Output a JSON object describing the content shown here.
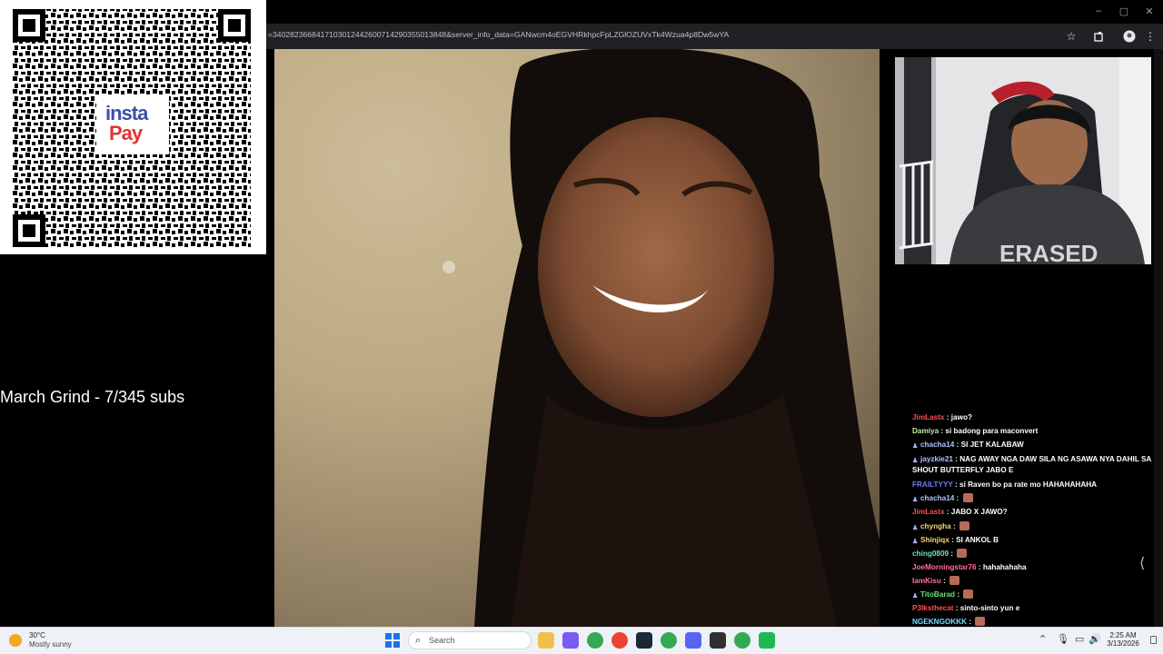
{
  "browser": {
    "url": "=3402823668417103012442600714290355013848&server_info_data=GANwcm4oEGVHRkhpcFpLZGlOZUVxTk4Wzua4p8Dw5wYA",
    "window_controls": [
      "–",
      "▢",
      "✕"
    ]
  },
  "qr": {
    "brand_top": "insta",
    "brand_bottom": "Pay"
  },
  "overlay": {
    "goal_text": "March Grind - 7/345 subs"
  },
  "camera": {
    "shirt_text": "ERASED"
  },
  "chat": {
    "messages": [
      {
        "user": "JimLastx",
        "color": "#ff4f4f",
        "text": "jawo?",
        "badge": false,
        "emote": false,
        "wrap": false
      },
      {
        "user": "Damiya",
        "color": "#c4e8a0",
        "text": "si badong para maconvert",
        "badge": false,
        "emote": false,
        "wrap": false
      },
      {
        "user": "chacha14",
        "color": "#b0c4ff",
        "text": "SI JET KALABAW",
        "badge": true,
        "emote": false,
        "wrap": false
      },
      {
        "user": "jayzkie21",
        "color": "#b0c4ff",
        "text": "NAG AWAY NGA DAW SILA NG ASAWA NYA DAHIL SA SHOUT BUTTERFLY JABO E",
        "badge": true,
        "emote": false,
        "wrap": true
      },
      {
        "user": "FRAILTYYY",
        "color": "#6d7cff",
        "text": "si Raven bo pa rate mo HAHAHAHAHA",
        "badge": false,
        "emote": false,
        "wrap": false
      },
      {
        "user": "chacha14",
        "color": "#b0c4ff",
        "text": "",
        "badge": true,
        "emote": true,
        "wrap": false
      },
      {
        "user": "JimLastx",
        "color": "#ff4f4f",
        "text": "JABO X JAWO?",
        "badge": false,
        "emote": false,
        "wrap": false
      },
      {
        "user": "chyngha",
        "color": "#ffd27a",
        "text": "",
        "badge": true,
        "emote": true,
        "wrap": false
      },
      {
        "user": "Shinjiqx",
        "color": "#ffd27a",
        "text": "SI ANKOL B",
        "badge": true,
        "emote": false,
        "wrap": false
      },
      {
        "user": "ching0809",
        "color": "#6fe0c0",
        "text": "",
        "badge": false,
        "emote": true,
        "wrap": false
      },
      {
        "user": "JoeMorningstar76",
        "color": "#ff6fa0",
        "text": "hahahahaha",
        "badge": false,
        "emote": false,
        "wrap": false
      },
      {
        "user": "IamKisu",
        "color": "#ff6fa0",
        "text": "",
        "badge": false,
        "emote": true,
        "wrap": false
      },
      {
        "user": "TitoBarad",
        "color": "#6fe07a",
        "text": "",
        "badge": true,
        "emote": true,
        "wrap": false
      },
      {
        "user": "P3lksthecat",
        "color": "#ff4f4f",
        "text": "sinto-sinto yun e",
        "badge": false,
        "emote": false,
        "wrap": false
      },
      {
        "user": "NGEKNGOKKK",
        "color": "#6fe0ff",
        "text": "",
        "badge": false,
        "emote": true,
        "wrap": false
      }
    ]
  },
  "taskbar": {
    "temperature": "30°C",
    "condition": "Mostly sunny",
    "search_placeholder": "Search",
    "time": "2:25 AM",
    "date": "3/13/2026",
    "app_icons": [
      {
        "name": "file-explorer",
        "color": "#f2c04a"
      },
      {
        "name": "copilot",
        "color": "#7a5cf0"
      },
      {
        "name": "chrome-profile-1",
        "color": "#34a853"
      },
      {
        "name": "chrome",
        "color": "#ea4335"
      },
      {
        "name": "steam",
        "color": "#1b2838"
      },
      {
        "name": "chrome-profile-2",
        "color": "#34a853"
      },
      {
        "name": "discord",
        "color": "#5865f2"
      },
      {
        "name": "obs",
        "color": "#302e31"
      },
      {
        "name": "chrome-profile-3",
        "color": "#34a853"
      },
      {
        "name": "spotify-like",
        "color": "#1db954"
      }
    ]
  }
}
